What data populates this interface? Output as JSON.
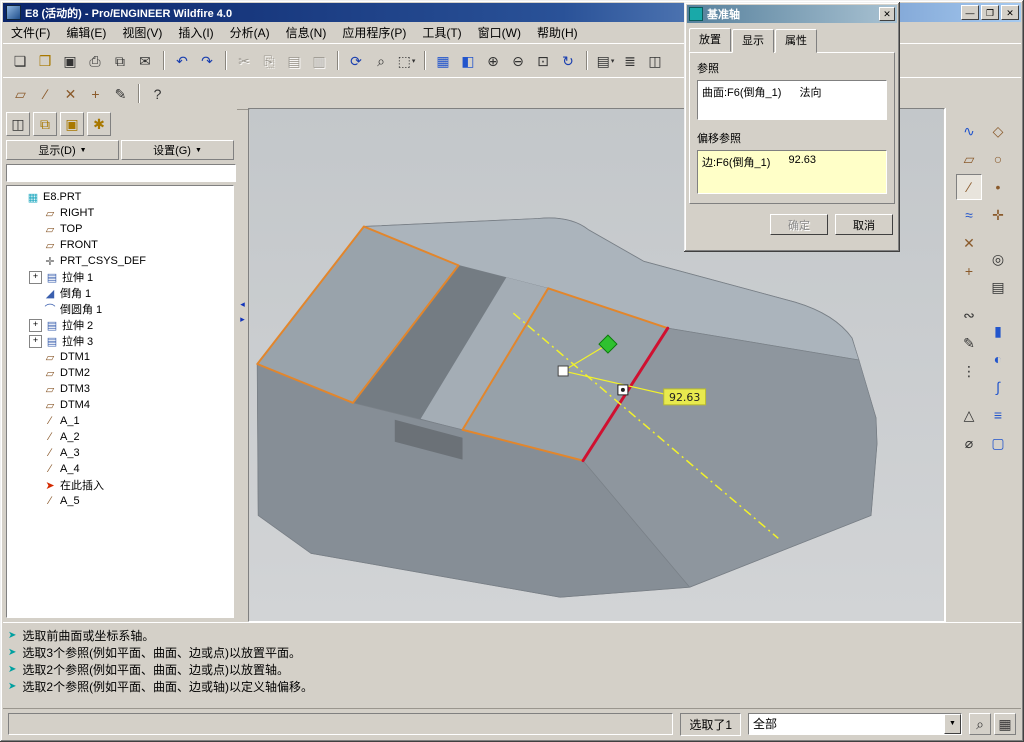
{
  "window": {
    "title": "E8 (活动的) - Pro/ENGINEER Wildfire 4.0",
    "controls": {
      "minimize": "—",
      "maximize": "❐",
      "close": "✕"
    }
  },
  "menu": {
    "items": [
      "文件(F)",
      "编辑(E)",
      "视图(V)",
      "插入(I)",
      "分析(A)",
      "信息(N)",
      "应用程序(P)",
      "工具(T)",
      "窗口(W)",
      "帮助(H)"
    ]
  },
  "toolbar_main": {
    "buttons": [
      {
        "name": "new-button",
        "glyph": "❏",
        "color": "#333333"
      },
      {
        "name": "open-button",
        "glyph": "❒",
        "color": "#a87800"
      },
      {
        "name": "save-button",
        "glyph": "▣",
        "color": "#333333"
      },
      {
        "name": "print-button",
        "glyph": "⎙",
        "color": "#333333"
      },
      {
        "name": "model-copy-button",
        "glyph": "⧉",
        "color": "#333333"
      },
      {
        "name": "mail-button",
        "glyph": "✉",
        "color": "#333333"
      },
      {
        "name": "undo-button",
        "glyph": "↶",
        "color": "#1a3faf",
        "cls": "group-start"
      },
      {
        "name": "redo-button",
        "glyph": "↷",
        "color": "#1a3faf"
      },
      {
        "name": "cut-button",
        "glyph": "✂",
        "state": "disabled",
        "cls": "group-start"
      },
      {
        "name": "copy-button",
        "glyph": "⎘",
        "state": "disabled"
      },
      {
        "name": "paste-button",
        "glyph": "▤",
        "state": "disabled"
      },
      {
        "name": "paste-special-button",
        "glyph": "▥",
        "state": "disabled"
      },
      {
        "name": "regenerate-button",
        "glyph": "⟳",
        "color": "#1a3faf",
        "cls": "group-start"
      },
      {
        "name": "find-button",
        "glyph": "⌕",
        "color": "#333333"
      },
      {
        "name": "selection-filter-button",
        "glyph": "⬚",
        "suffix": "▾",
        "color": "#333333"
      },
      {
        "name": "repaint-button",
        "glyph": "▦",
        "color": "#2255cc",
        "cls": "group-start"
      },
      {
        "name": "shaded-view-button",
        "glyph": "◧",
        "color": "#2255cc"
      },
      {
        "name": "zoom-in-button",
        "glyph": "⊕",
        "color": "#333333"
      },
      {
        "name": "zoom-out-button",
        "glyph": "⊖",
        "color": "#333333"
      },
      {
        "name": "refit-button",
        "glyph": "⊡",
        "color": "#333333"
      },
      {
        "name": "reorient-button",
        "glyph": "↻",
        "color": "#1a3faf"
      },
      {
        "name": "saved-views-button",
        "glyph": "▤",
        "suffix": "▾",
        "color": "#333333",
        "cls": "group-start"
      },
      {
        "name": "layers-button",
        "glyph": "≣",
        "color": "#333333"
      },
      {
        "name": "view-manager-button",
        "glyph": "◫",
        "color": "#333333"
      }
    ]
  },
  "toolbar_datum": {
    "buttons": [
      {
        "name": "datum-plane-button",
        "glyph": "▱",
        "color": "#8a5a2b"
      },
      {
        "name": "datum-axis-button",
        "glyph": "∕",
        "color": "#8a5a2b"
      },
      {
        "name": "datum-point-button",
        "glyph": "✕",
        "color": "#8a5a2b"
      },
      {
        "name": "datum-csys-button",
        "glyph": "+",
        "color": "#8a5a2b"
      },
      {
        "name": "sketch-tool-button",
        "glyph": "✎",
        "color": "#333333"
      },
      {
        "name": "context-help-button",
        "glyph": "?",
        "color": "#333333",
        "cls": "group-start"
      }
    ]
  },
  "tree_panel": {
    "tools": [
      {
        "name": "model-tree-toggle-button",
        "glyph": "◫",
        "color": "#333333"
      },
      {
        "name": "folder-browser-button",
        "glyph": "⧉",
        "color": "#a87800"
      },
      {
        "name": "favorites-button",
        "glyph": "▣",
        "color": "#a87800"
      },
      {
        "name": "connections-button",
        "glyph": "✱",
        "color": "#a87800"
      }
    ],
    "show_button": "显示(D)",
    "settings_button": "设置(G)",
    "dropdown_glyph": "▼",
    "filter_value": "",
    "items": [
      {
        "label": "E8.PRT",
        "glyph": "▦",
        "color": "#1fa8c0",
        "cls": "root"
      },
      {
        "label": "RIGHT",
        "glyph": "▱",
        "color": "#8a5a2b"
      },
      {
        "label": "TOP",
        "glyph": "▱",
        "color": "#8a5a2b"
      },
      {
        "label": "FRONT",
        "glyph": "▱",
        "color": "#8a5a2b"
      },
      {
        "label": "PRT_CSYS_DEF",
        "glyph": "✛",
        "color": "#555555"
      },
      {
        "label": "拉伸 1",
        "glyph": "▤",
        "color": "#3a5fae",
        "exp": "has-plus"
      },
      {
        "label": "倒角 1",
        "glyph": "◢",
        "color": "#3a5fae"
      },
      {
        "label": "倒圆角 1",
        "glyph": "⌒",
        "color": "#3a5fae"
      },
      {
        "label": "拉伸 2",
        "glyph": "▤",
        "color": "#3a5fae",
        "exp": "has-plus"
      },
      {
        "label": "拉伸 3",
        "glyph": "▤",
        "color": "#3a5fae",
        "exp": "has-plus"
      },
      {
        "label": "DTM1",
        "glyph": "▱",
        "color": "#8a5a2b"
      },
      {
        "label": "DTM2",
        "glyph": "▱",
        "color": "#8a5a2b"
      },
      {
        "label": "DTM3",
        "glyph": "▱",
        "color": "#8a5a2b"
      },
      {
        "label": "DTM4",
        "glyph": "▱",
        "color": "#8a5a2b"
      },
      {
        "label": "A_1",
        "glyph": "∕",
        "color": "#8a5a2b"
      },
      {
        "label": "A_2",
        "glyph": "∕",
        "color": "#8a5a2b"
      },
      {
        "label": "A_3",
        "glyph": "∕",
        "color": "#8a5a2b"
      },
      {
        "label": "A_4",
        "glyph": "∕",
        "color": "#8a5a2b"
      },
      {
        "label": "在此插入",
        "glyph": "➤",
        "color": "#d42a00"
      },
      {
        "label": "A_5",
        "glyph": "∕",
        "color": "#8a5a2b"
      }
    ]
  },
  "right_toolbar": {
    "column_a": [
      {
        "name": "insert-datum-curve-button",
        "glyph": "∿",
        "color": "#2255cc"
      },
      {
        "name": "datum-plane-tool-button",
        "glyph": "▱",
        "color": "#8a5a2b"
      },
      {
        "name": "datum-axis-tool-button",
        "glyph": "∕",
        "color": "#8a5a2b",
        "state": "active"
      },
      {
        "name": "sketched-curve-button",
        "glyph": "≈",
        "color": "#2255cc"
      },
      {
        "name": "datum-point-tool-button",
        "glyph": "✕",
        "color": "#8a5a2b"
      },
      {
        "name": "datum-csys-tool-button",
        "glyph": "+",
        "color": "#8a5a2b"
      },
      {
        "name": "use-edge-button",
        "glyph": "∾",
        "color": "#333333",
        "cls": "gap-top"
      },
      {
        "name": "sketcher-button",
        "glyph": "✎",
        "color": "#333333"
      },
      {
        "name": "pattern-button",
        "glyph": "⋮",
        "color": "#333333"
      },
      {
        "name": "analysis-button",
        "glyph": "△",
        "color": "#333333",
        "cls": "gap-top"
      },
      {
        "name": "measure-button",
        "glyph": "⌀",
        "color": "#333333"
      }
    ],
    "column_b": [
      {
        "name": "plane-display-button",
        "glyph": "◇",
        "color": "#8a5a2b"
      },
      {
        "name": "axis-display-button",
        "glyph": "○",
        "color": "#8a5a2b"
      },
      {
        "name": "point-display-button",
        "glyph": "•",
        "color": "#8a5a2b"
      },
      {
        "name": "csys-display-button",
        "glyph": "✛",
        "color": "#8a5a2b"
      },
      {
        "name": "spin-center-button",
        "glyph": "◎",
        "color": "#333333",
        "cls": "gap-top"
      },
      {
        "name": "annotation-button",
        "glyph": "▤",
        "color": "#333333"
      },
      {
        "name": "extrude-button",
        "glyph": "▮",
        "color": "#2255cc",
        "cls": "gap-top"
      },
      {
        "name": "revolve-button",
        "glyph": "◐",
        "color": "#2255cc"
      },
      {
        "name": "sweep-button",
        "glyph": "∫",
        "color": "#2255cc"
      },
      {
        "name": "blend-button",
        "glyph": "≡",
        "color": "#2255cc"
      },
      {
        "name": "shell-button",
        "glyph": "▢",
        "color": "#2255cc"
      }
    ]
  },
  "viewport": {
    "dimension_label": "92.63",
    "highlight_color": "#e2862c",
    "selected_edge_color": "#d01030",
    "preview_color": "#f2f22a",
    "handle_color": "#2fc12f"
  },
  "dialog": {
    "title": "基准轴",
    "close_glyph": "✕",
    "tabs": [
      {
        "label": "放置",
        "state": "active"
      },
      {
        "label": "显示"
      },
      {
        "label": "属性"
      }
    ],
    "ref_section_label": "参照",
    "ref_rows": [
      {
        "text": "曲面:F6(倒角_1)",
        "value": "法向"
      }
    ],
    "offset_section_label": "偏移参照",
    "offset_rows": [
      {
        "text": "边:F6(倒角_1)",
        "value": "92.63"
      }
    ],
    "ok_label": "确定",
    "cancel_label": "取消"
  },
  "messages": {
    "icon_glyph": "➤",
    "items": [
      "选取前曲面或坐标系轴。",
      "选取3个参照(例如平面、曲面、边或点)以放置平面。",
      "选取2个参照(例如平面、曲面、边或点)以放置轴。",
      "选取2个参照(例如平面、曲面、边或轴)以定义轴偏移。"
    ]
  },
  "status": {
    "message": "",
    "selection_label": "选取了1",
    "filter_value": "全部",
    "dropdown_glyph": "▼",
    "buttons": [
      {
        "name": "status-find-button",
        "glyph": "⌕",
        "color": "#333333"
      },
      {
        "name": "status-select-button",
        "glyph": "▦",
        "color": "#333333"
      }
    ]
  }
}
